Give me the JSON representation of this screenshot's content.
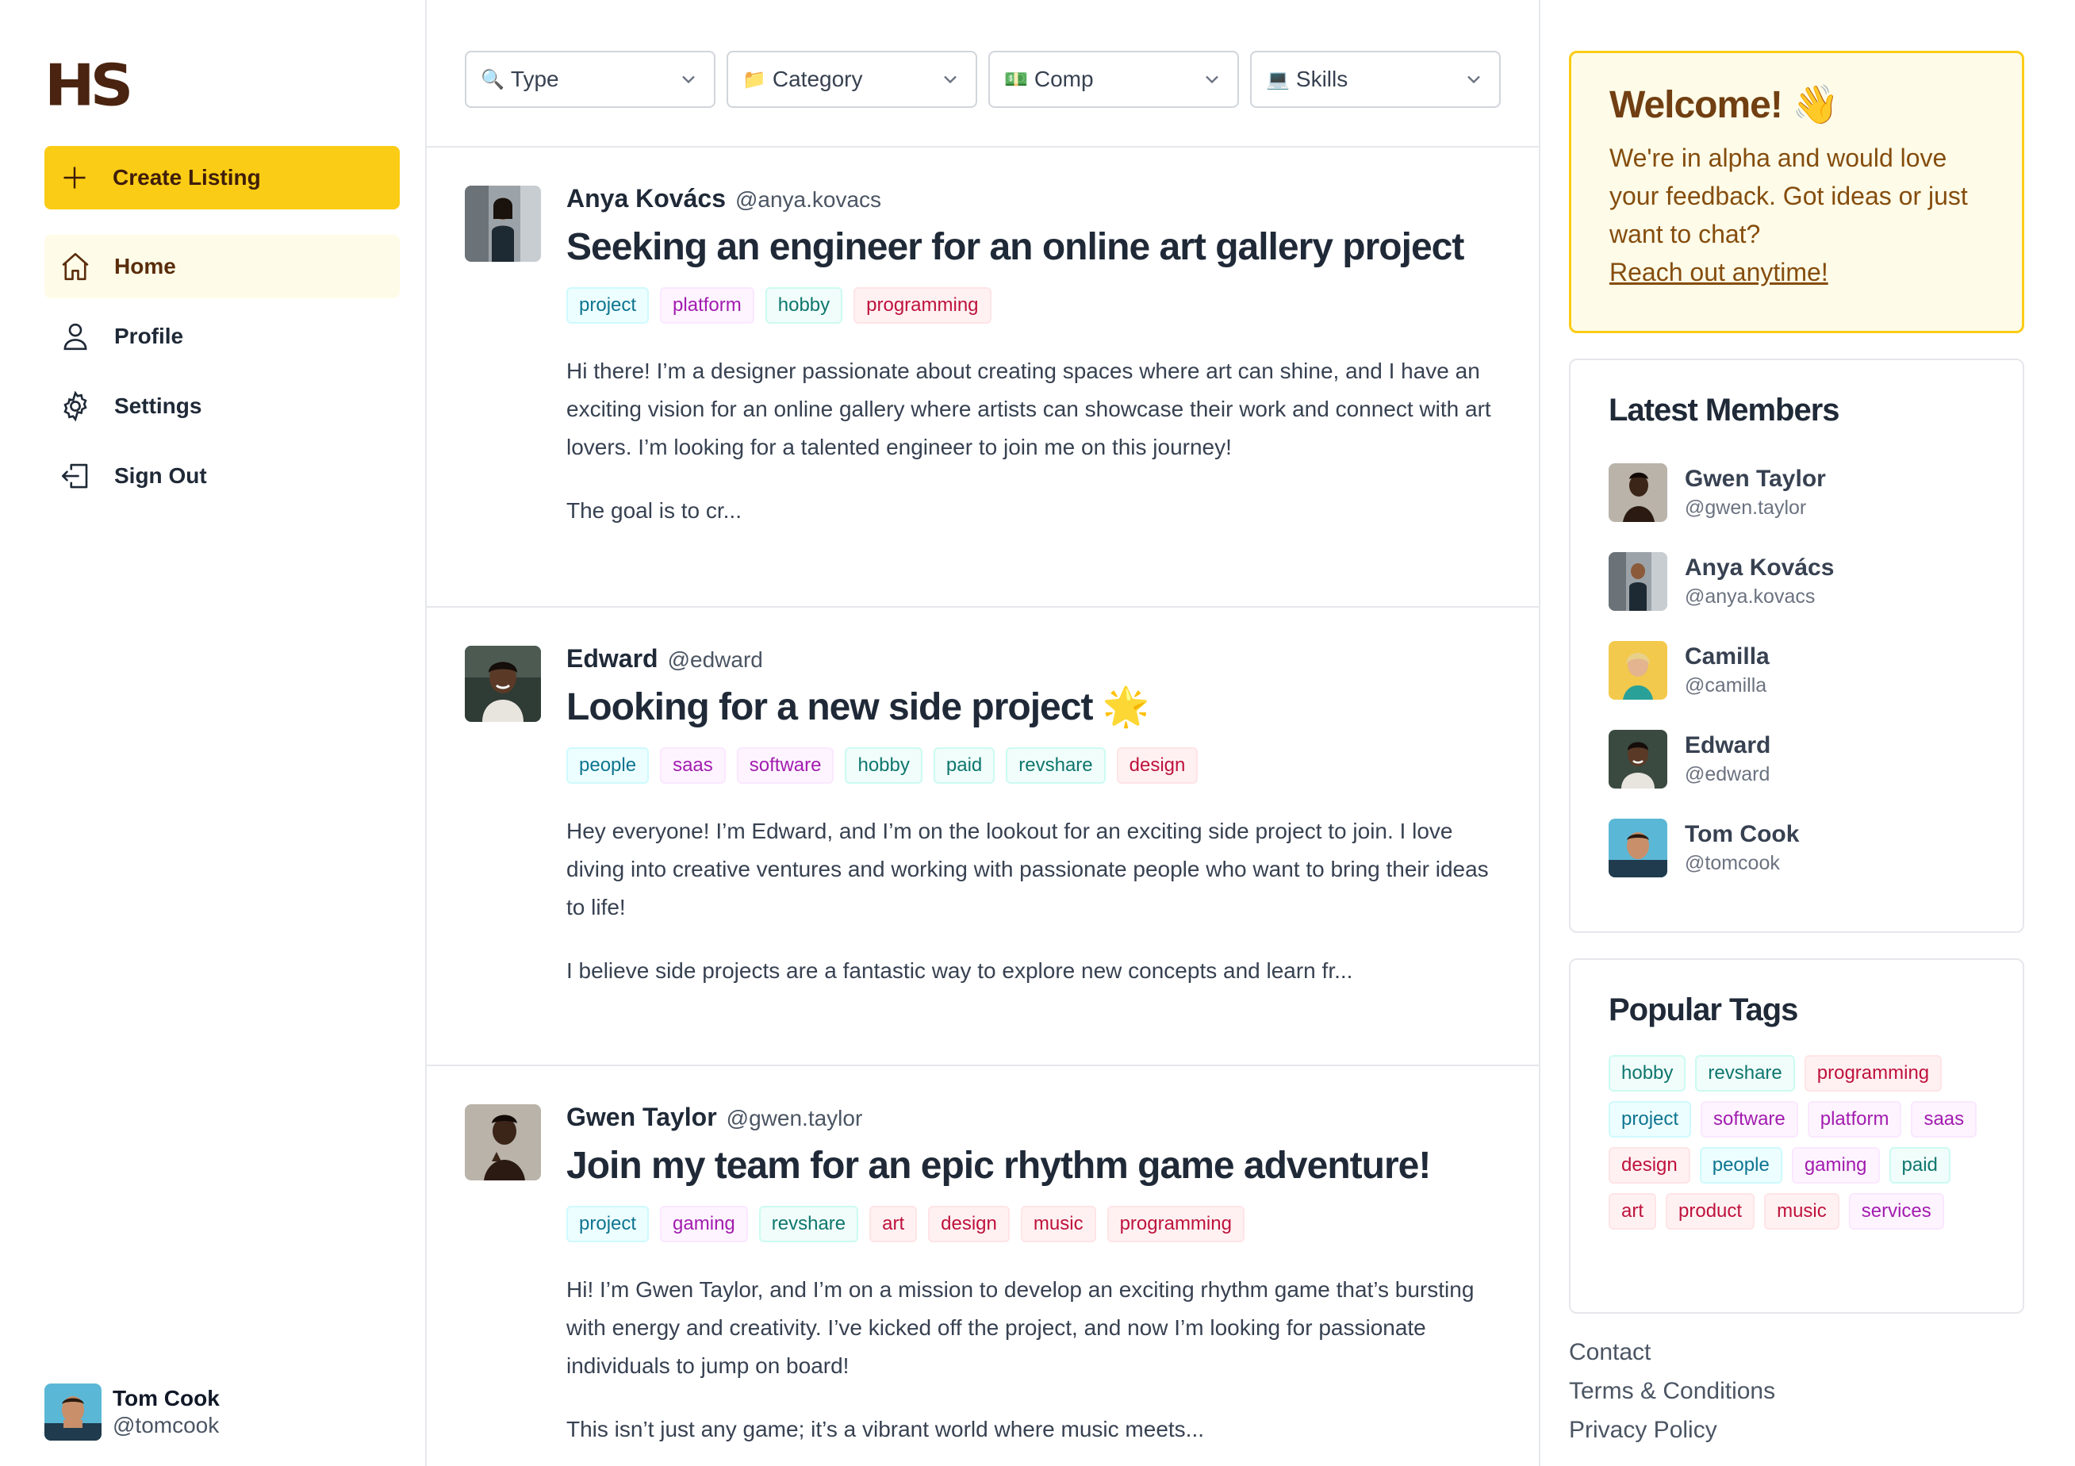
{
  "brand": {
    "logo_text": "HS"
  },
  "sidebar": {
    "create_label": "Create Listing",
    "nav": [
      {
        "label": "Home",
        "icon": "home-icon",
        "active": true
      },
      {
        "label": "Profile",
        "icon": "user-icon"
      },
      {
        "label": "Settings",
        "icon": "gear-icon"
      },
      {
        "label": "Sign Out",
        "icon": "sign-out-icon"
      }
    ],
    "user": {
      "name": "Tom Cook",
      "handle": "@tomcook"
    }
  },
  "filters": [
    {
      "emoji": "🔍",
      "label": "Type"
    },
    {
      "emoji": "📁",
      "label": "Category"
    },
    {
      "emoji": "💵",
      "label": "Comp"
    },
    {
      "emoji": "💻",
      "label": "Skills"
    }
  ],
  "posts": [
    {
      "name": "Anya Kovács",
      "handle": "@anya.kovacs",
      "title": "Seeking an engineer for an online art gallery project",
      "tags": [
        "project",
        "platform",
        "hobby",
        "programming"
      ],
      "paragraphs": [
        "Hi there! I’m a designer passionate about creating spaces where art can shine, and I have an exciting vision for an online gallery where artists can showcase their work and connect with art lovers. I’m looking for a talented engineer to join me on this journey!",
        "The goal is to cr..."
      ]
    },
    {
      "name": "Edward",
      "handle": "@edward",
      "title": "Looking for a new side project 🌟",
      "tags": [
        "people",
        "saas",
        "software",
        "hobby",
        "paid",
        "revshare",
        "design"
      ],
      "paragraphs": [
        "Hey everyone! I’m Edward, and I’m on the lookout for an exciting side project to join. I love diving into creative ventures and working with passionate people who want to bring their ideas to life!",
        "I believe side projects are a fantastic way to explore new concepts and learn fr..."
      ]
    },
    {
      "name": "Gwen Taylor",
      "handle": "@gwen.taylor",
      "title": "Join my team for an epic rhythm game adventure!",
      "tags": [
        "project",
        "gaming",
        "revshare",
        "art",
        "design",
        "music",
        "programming"
      ],
      "paragraphs": [
        "Hi! I’m Gwen Taylor, and I’m on a mission to develop an exciting rhythm game that’s bursting with energy and creativity. I’ve kicked off the project, and now I’m looking for passionate individuals to jump on board!",
        "This isn’t just any game; it’s a vibrant world where music meets..."
      ]
    }
  ],
  "welcome": {
    "title": "Welcome! 👋",
    "text": "We're in alpha and would love your feedback. Got ideas or just want to chat?",
    "link": "Reach out anytime!"
  },
  "latest_members": {
    "title": "Latest Members",
    "members": [
      {
        "name": "Gwen Taylor",
        "handle": "@gwen.taylor"
      },
      {
        "name": "Anya Kovács",
        "handle": "@anya.kovacs"
      },
      {
        "name": "Camilla",
        "handle": "@camilla"
      },
      {
        "name": "Edward",
        "handle": "@edward"
      },
      {
        "name": "Tom Cook",
        "handle": "@tomcook"
      }
    ]
  },
  "popular_tags": {
    "title": "Popular Tags",
    "tags": [
      "hobby",
      "revshare",
      "programming",
      "project",
      "software",
      "platform",
      "saas",
      "design",
      "people",
      "gaming",
      "paid",
      "art",
      "product",
      "music",
      "services"
    ]
  },
  "footer": {
    "links": [
      "Contact",
      "Terms & Conditions",
      "Privacy Policy"
    ]
  },
  "tag_styles": {
    "project": "cyan",
    "people": "cyan",
    "platform": "pink",
    "saas": "pink",
    "software": "pink",
    "gaming": "pink",
    "services": "pink",
    "hobby": "teal",
    "paid": "teal",
    "revshare": "teal",
    "programming": "rose",
    "design": "rose",
    "art": "rose",
    "music": "rose",
    "product": "rose"
  },
  "colors": {
    "accent": "#facc15",
    "brand": "#4a2410"
  }
}
